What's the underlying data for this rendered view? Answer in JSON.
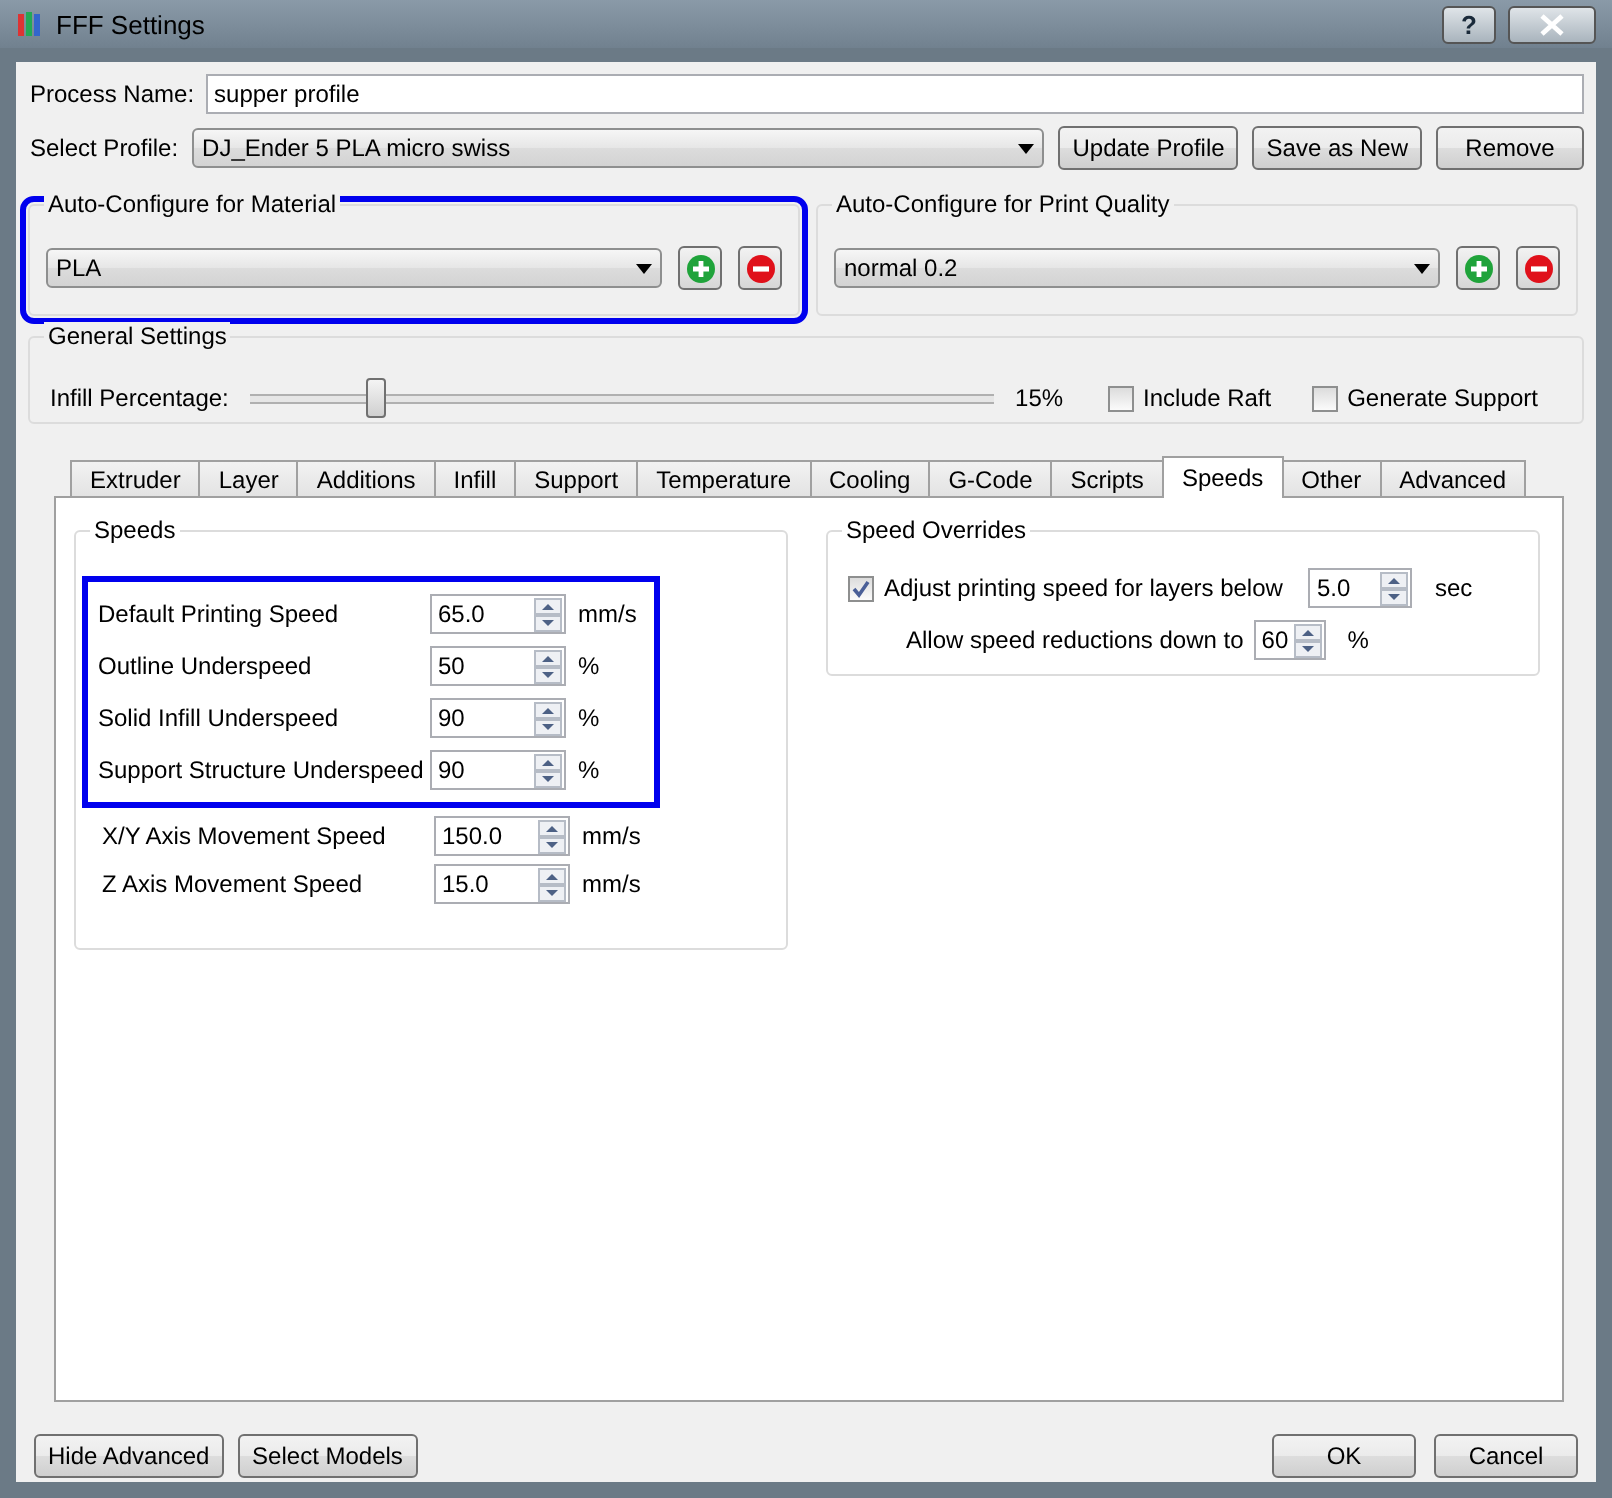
{
  "window": {
    "title": "FFF Settings",
    "help_button": "?"
  },
  "process_name": {
    "label": "Process Name:",
    "value": "supper profile"
  },
  "select_profile": {
    "label": "Select Profile:",
    "value": "DJ_Ender 5 PLA micro swiss",
    "buttons": [
      "Update Profile",
      "Save as New",
      "Remove"
    ]
  },
  "auto_material": {
    "title": "Auto-Configure for Material",
    "value": "PLA",
    "highlighted": true
  },
  "auto_quality": {
    "title": "Auto-Configure for Print Quality",
    "value": "normal 0.2",
    "highlighted": false
  },
  "general": {
    "title": "General Settings",
    "infill_label": "Infill Percentage:",
    "level": 0.16,
    "reading": "15%",
    "checkboxes": [
      {
        "label": "Include Raft",
        "checked": false
      },
      {
        "label": "Generate Support",
        "checked": false
      }
    ]
  },
  "tabs": [
    {
      "label": "Extruder",
      "selected": false
    },
    {
      "label": "Layer",
      "selected": false
    },
    {
      "label": "Additions",
      "selected": false
    },
    {
      "label": "Infill",
      "selected": false
    },
    {
      "label": "Support",
      "selected": false
    },
    {
      "label": "Temperature",
      "selected": false
    },
    {
      "label": "Cooling",
      "selected": false
    },
    {
      "label": "G-Code",
      "selected": false
    },
    {
      "label": "Scripts",
      "selected": false
    },
    {
      "label": "Speeds",
      "selected": true
    },
    {
      "label": "Other",
      "selected": false
    },
    {
      "label": "Advanced",
      "selected": false
    }
  ],
  "speeds": {
    "title": "Speeds",
    "rows": [
      {
        "label": "Default Printing Speed",
        "value": "65.0",
        "unit": "mm/s",
        "highlighted": true
      },
      {
        "label": "Outline Underspeed",
        "value": "50",
        "unit": "%",
        "highlighted": true
      },
      {
        "label": "Solid Infill Underspeed",
        "value": "90",
        "unit": "%",
        "highlighted": true
      },
      {
        "label": "Support Structure Underspeed",
        "value": "90",
        "unit": "%",
        "highlighted": true
      },
      {
        "label": "X/Y Axis Movement Speed",
        "value": "150.0",
        "unit": "mm/s",
        "highlighted": false
      },
      {
        "label": "Z Axis Movement Speed",
        "value": "15.0",
        "unit": "mm/s",
        "highlighted": false
      }
    ]
  },
  "speed_overrides": {
    "title": "Speed Overrides",
    "adjust": {
      "label": "Adjust printing speed for layers below",
      "checked": true,
      "value": "5.0",
      "unit": "sec"
    },
    "reduction": {
      "label": "Allow speed reductions down to",
      "value": "60",
      "unit": "%"
    }
  },
  "bottom_buttons_left": [
    "Hide Advanced",
    "Select Models"
  ],
  "bottom_buttons_right": [
    "OK",
    "Cancel"
  ]
}
